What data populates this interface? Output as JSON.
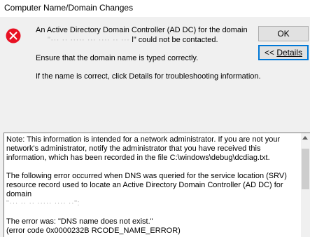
{
  "window": {
    "title": "Computer Name/Domain Changes"
  },
  "message": {
    "line1": "An Active Directory Domain Controller (AD DC) for the domain",
    "line2_blurred": "\"··· ·· ····· ··· ···· ·· ···",
    "line2_suffix": "l\" could not be contacted.",
    "line3": "Ensure that the domain name is typed correctly.",
    "line4": "If the name is correct, click Details for troubleshooting information."
  },
  "buttons": {
    "ok_label": "OK",
    "details_prefix": "<< ",
    "details_label": "Details"
  },
  "details": {
    "para1": "Note: This information is intended for a network administrator.  If you are not your network's administrator, notify the administrator that you have received this information, which has been recorded in the file C:\\windows\\debug\\dcdiag.txt.",
    "para2_main": "The following error occurred when DNS was queried for the service location (SRV) resource record used to locate an Active Directory Domain Controller (AD DC) for domain",
    "para2_blurred": "\"··· ·· ·· ····· ···· ··\":",
    "para3_line1": "The error was: \"DNS name does not exist.\"",
    "para3_line2": "(error code 0x0000232B RCODE_NAME_ERROR)"
  },
  "icons": {
    "error": "error-x-icon",
    "error_color": "#e81123"
  }
}
